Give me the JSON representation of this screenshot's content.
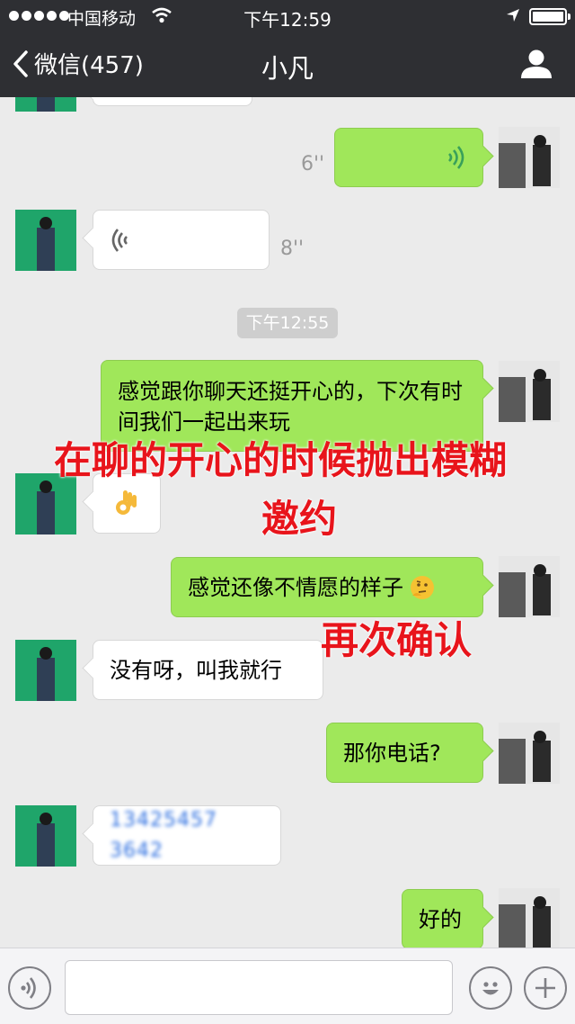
{
  "status_bar": {
    "carrier": "中国移动",
    "time": "下午12:59"
  },
  "nav": {
    "back_label": "微信(457)",
    "title": "小凡"
  },
  "messages": {
    "voice_out_duration": "6''",
    "voice_in_duration": "8''",
    "timestamp": "下午12:55",
    "out_1": "感觉跟你聊天还挺开心的，下次有时间我们一起出来玩",
    "out_2": "感觉还像不情愿的样子",
    "in_2": "没有呀，叫我就行",
    "out_3": "那你电话?",
    "in_3_blurred": "13425457 3642",
    "out_4": "好的"
  },
  "annotations": {
    "line_1": "在聊的开心的时候抛出模糊",
    "line_2": "邀约",
    "line_3": "再次确认"
  },
  "colors": {
    "header_bg": "#2e2f33",
    "chat_bg": "#ebebeb",
    "bubble_out": "#a0e75a",
    "bubble_in": "#ffffff",
    "annotation": "#e8141b"
  },
  "icons": {
    "back": "chevron-left-icon",
    "profile": "person-icon",
    "voice": "voice-wave-icon",
    "emoji": "smiley-icon",
    "add": "plus-icon"
  }
}
